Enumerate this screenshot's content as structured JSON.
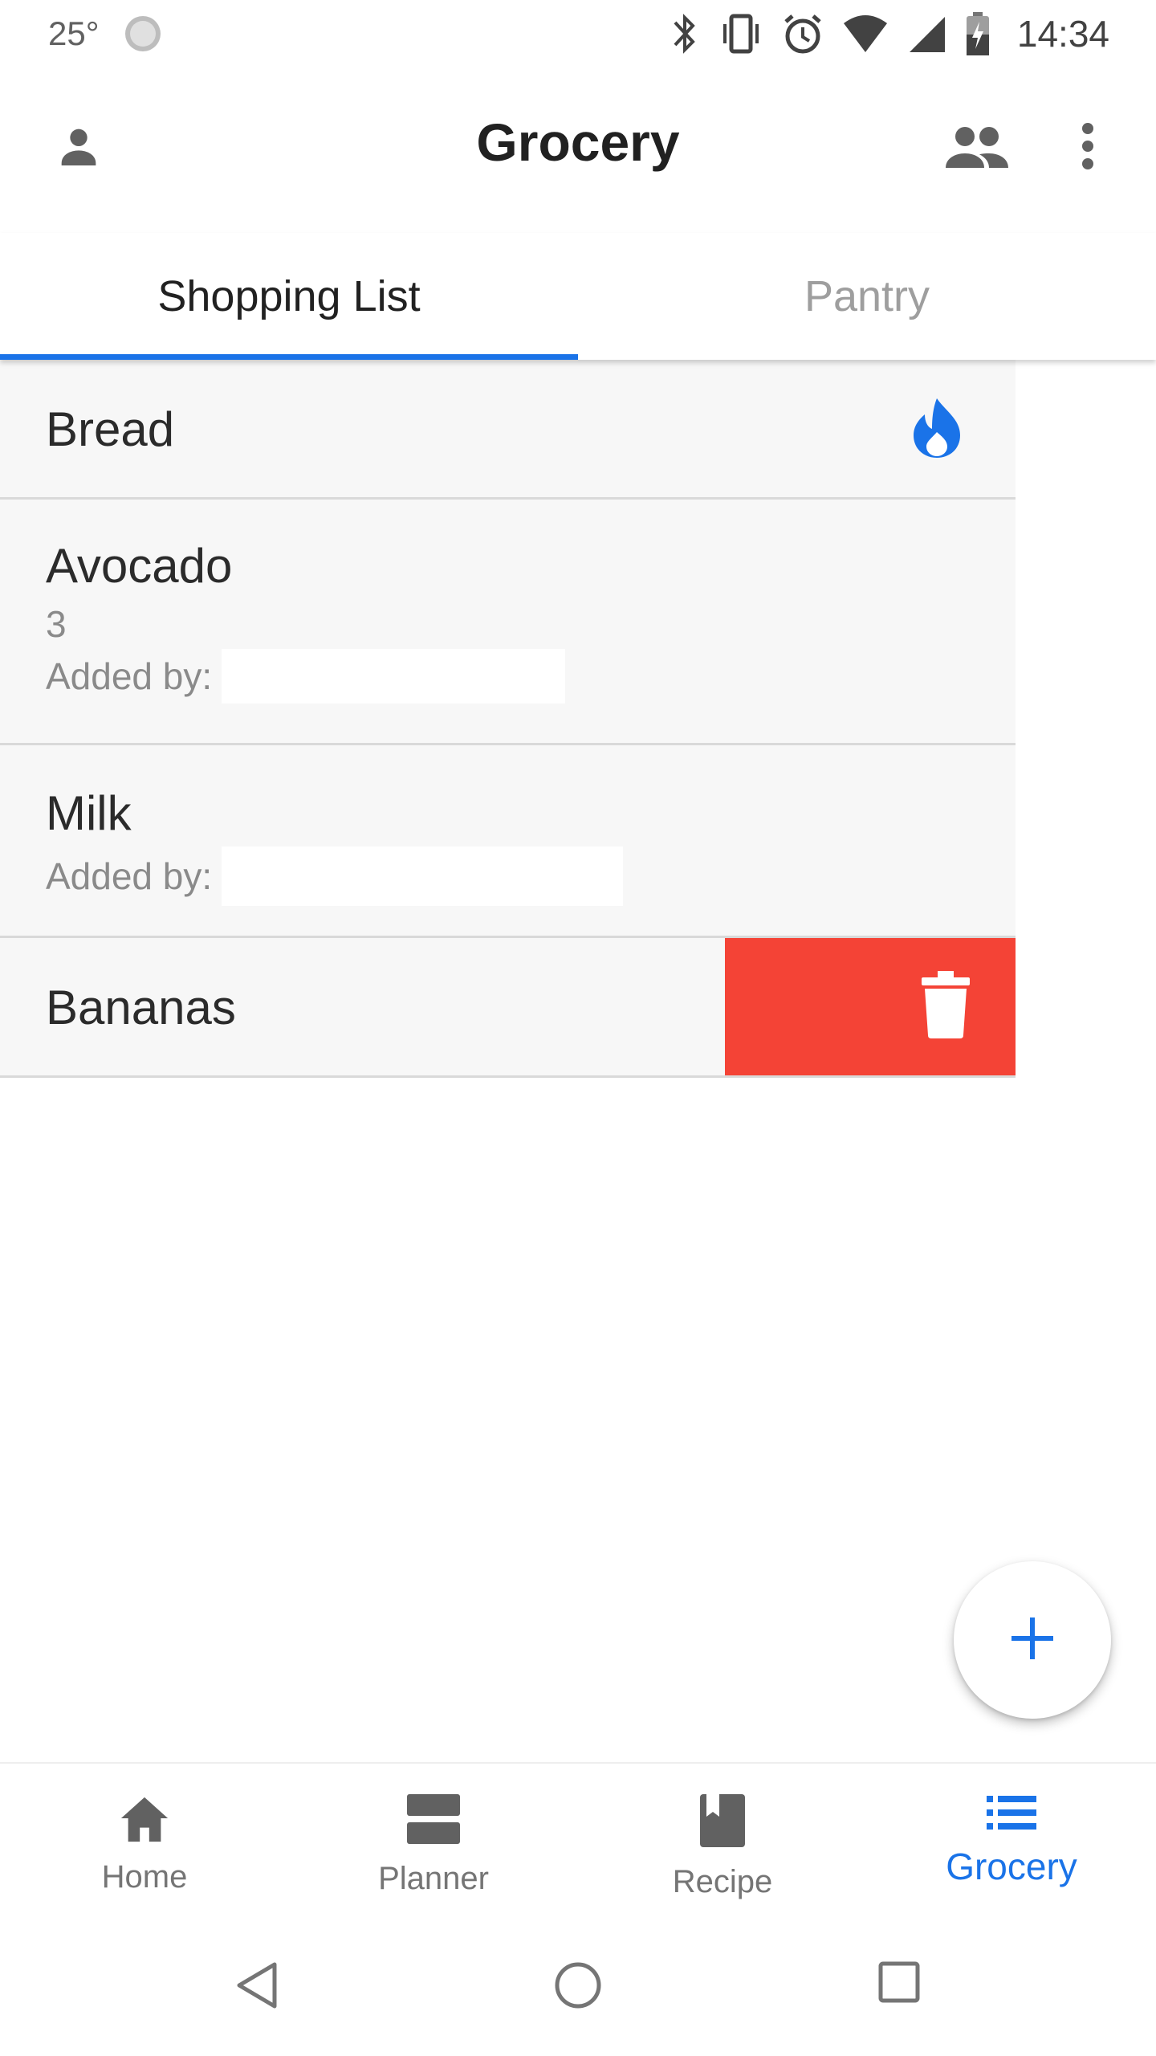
{
  "status_bar": {
    "temperature": "25°",
    "time": "14:34"
  },
  "app_bar": {
    "title": "Grocery"
  },
  "tabs": [
    {
      "label": "Shopping List",
      "active": true
    },
    {
      "label": "Pantry",
      "active": false
    }
  ],
  "list": {
    "items": [
      {
        "name": "Bread",
        "badge_icon": "flame-icon"
      },
      {
        "name": "Avocado",
        "quantity": "3",
        "added_by_label": "Added by:"
      },
      {
        "name": "Milk",
        "added_by_label": "Added by:"
      },
      {
        "name": "Bananas",
        "swipe_action": "trash-icon"
      }
    ]
  },
  "bottom_nav": {
    "items": [
      {
        "label": "Home",
        "icon": "home-icon"
      },
      {
        "label": "Planner",
        "icon": "planner-icon"
      },
      {
        "label": "Recipe",
        "icon": "book-icon"
      },
      {
        "label": "Grocery",
        "icon": "list-icon",
        "active": true
      }
    ]
  },
  "colors": {
    "accent": "#1a73e8",
    "delete": "#f44336"
  }
}
